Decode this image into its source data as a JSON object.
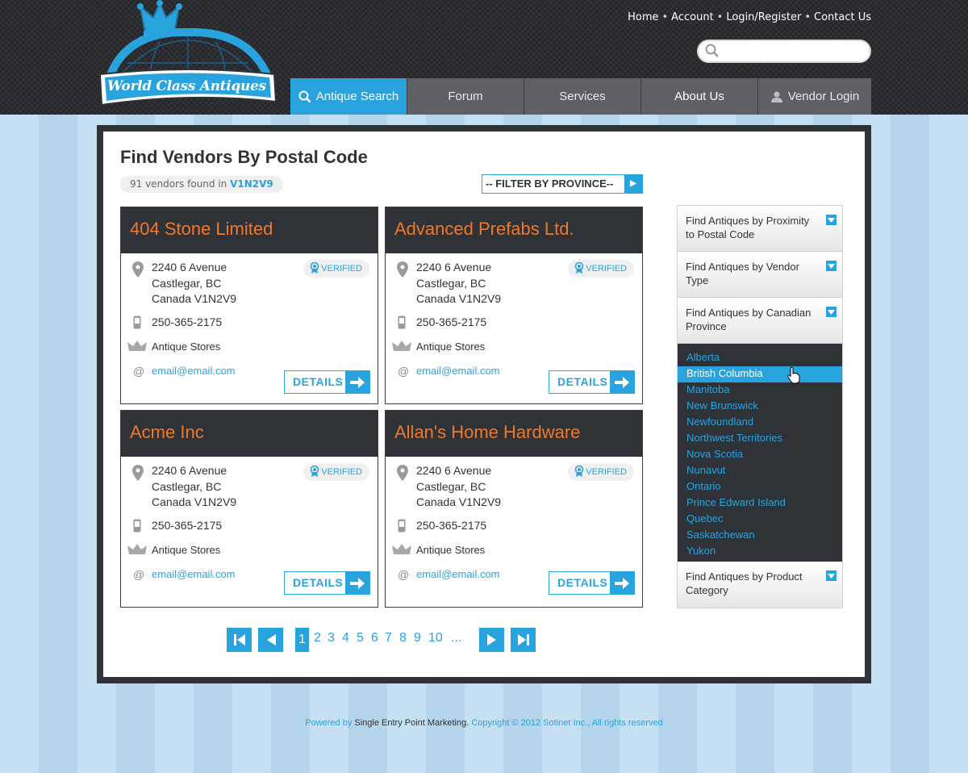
{
  "brand": {
    "name": "World Class Antiques",
    "accent": "#29a3de",
    "title_color": "#f0782a"
  },
  "toplinks": [
    "Home",
    "Account",
    "Login/Register",
    "Contact Us"
  ],
  "search": {
    "placeholder": ""
  },
  "nav": [
    {
      "label": "Antique Search",
      "icon": "search-icon"
    },
    {
      "label": "Forum"
    },
    {
      "label": "Services"
    },
    {
      "label": "About Us"
    },
    {
      "label": "Vendor Login",
      "icon": "user-icon"
    }
  ],
  "page": {
    "title": "Find Vendors By Postal Code",
    "found_prefix": "91 vendors found in",
    "postal_code": "V1N2V9",
    "filter_label": "-- FILTER BY PROVINCE--"
  },
  "vendors": [
    {
      "name": "404 Stone Limited",
      "address1": "2240 6 Avenue",
      "address2": "Castlegar, BC",
      "address3": "Canada V1N2V9",
      "phone": "250-365-2175",
      "type": "Antique Stores",
      "email": "email@email.com",
      "verified": "VERIFIED",
      "details": "DETAILS"
    },
    {
      "name": "Advanced Prefabs Ltd.",
      "address1": "2240 6 Avenue",
      "address2": "Castlegar, BC",
      "address3": "Canada V1N2V9",
      "phone": "250-365-2175",
      "type": "Antique Stores",
      "email": "email@email.com",
      "verified": "VERIFIED",
      "details": "DETAILS"
    },
    {
      "name": "Acme Inc",
      "address1": "2240 6 Avenue",
      "address2": "Castlegar, BC",
      "address3": "Canada V1N2V9",
      "phone": "250-365-2175",
      "type": "Antique Stores",
      "email": "email@email.com",
      "verified": "VERIFIED",
      "details": "DETAILS"
    },
    {
      "name": "Allan's Home Hardware",
      "address1": "2240 6 Avenue",
      "address2": "Castlegar, BC",
      "address3": "Canada V1N2V9",
      "phone": "250-365-2175",
      "type": "Antique Stores",
      "email": "email@email.com",
      "verified": "VERIFIED",
      "details": "DETAILS"
    }
  ],
  "pagination": {
    "pages": [
      "1",
      "2",
      "3",
      "4",
      "5",
      "6",
      "7",
      "8",
      "9",
      "10",
      "..."
    ],
    "current": "1"
  },
  "sidebar": {
    "sections": [
      "Find Antiques by Proximity to Postal Code",
      "Find Antiques by Vendor Type",
      "Find Antiques by Canadian Province",
      "Find Antiques by Product Category"
    ],
    "provinces": [
      "Alberta",
      "British Columbia",
      "Manitoba",
      "New Brunswick",
      "Newfoundland",
      "Northwest Territories",
      "Nova Scotia",
      "Nunavut",
      "Ontario",
      "Prince Edward Island",
      "Quebec",
      "Saskatchewan",
      "Yukon"
    ],
    "selected_province": "British Columbia"
  },
  "footer": {
    "powered_by": "Powered by",
    "company": "Single Entry Point Marketing.",
    "copyright": "Copyright © 2012 Sotinet Inc., All rights reserved"
  }
}
